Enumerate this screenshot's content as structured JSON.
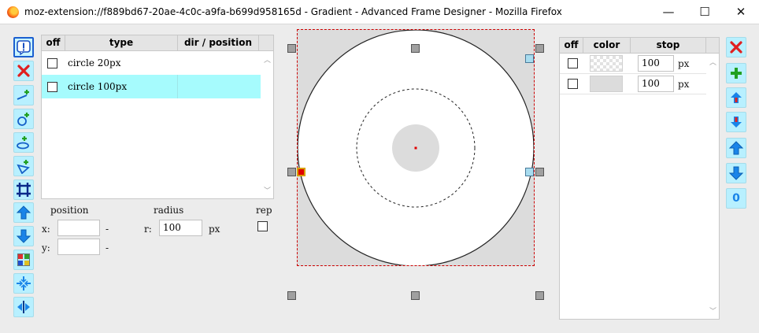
{
  "window": {
    "title": "moz-extension://f889bd67-20ae-4c0c-a9fa-b699d958165d - Gradient - Advanced Frame Designer - Mozilla Firefox",
    "minimize_glyph": "—",
    "maximize_glyph": "☐",
    "close_glyph": "✕"
  },
  "left_toolbar": {
    "icons": [
      "info-icon",
      "delete-icon",
      "add-linear-icon",
      "add-radial-icon",
      "add-elliptic-icon",
      "add-conic-icon",
      "frame-icon",
      "move-up-icon",
      "move-down-icon",
      "palette-icon",
      "center-icon",
      "mirror-icon"
    ]
  },
  "layers": {
    "headers": {
      "off": "off",
      "type": "type",
      "dir_position": "dir / position"
    },
    "rows": [
      {
        "label": "circle 20px",
        "selected": false
      },
      {
        "label": "circle 100px",
        "selected": true
      }
    ]
  },
  "properties": {
    "position_label": "position",
    "radius_label": "radius",
    "rep_label": "rep",
    "x_label": "x:",
    "y_label": "y:",
    "x_value": "",
    "y_value": "",
    "x_dash": "-",
    "y_dash": "-",
    "r_label": "r:",
    "r_value": "100",
    "r_unit": "px"
  },
  "stops": {
    "headers": {
      "off": "off",
      "color": "color",
      "stop": "stop"
    },
    "rows": [
      {
        "value": "100",
        "unit": "px",
        "color": "transparent"
      },
      {
        "value": "100",
        "unit": "px",
        "color": "#dcdcdc"
      }
    ]
  },
  "right_toolbar": {
    "icons": [
      "delete-stop-icon",
      "add-stop-icon",
      "move-stop-up-icon",
      "move-stop-down-icon",
      "up-arrow-icon",
      "down-arrow-icon",
      "zero-icon"
    ],
    "zero_label": "0"
  },
  "colors": {
    "selection": "#a6fbfd",
    "button_bg": "#b8f0ff",
    "canvas_bg": "#dcdcdc"
  }
}
